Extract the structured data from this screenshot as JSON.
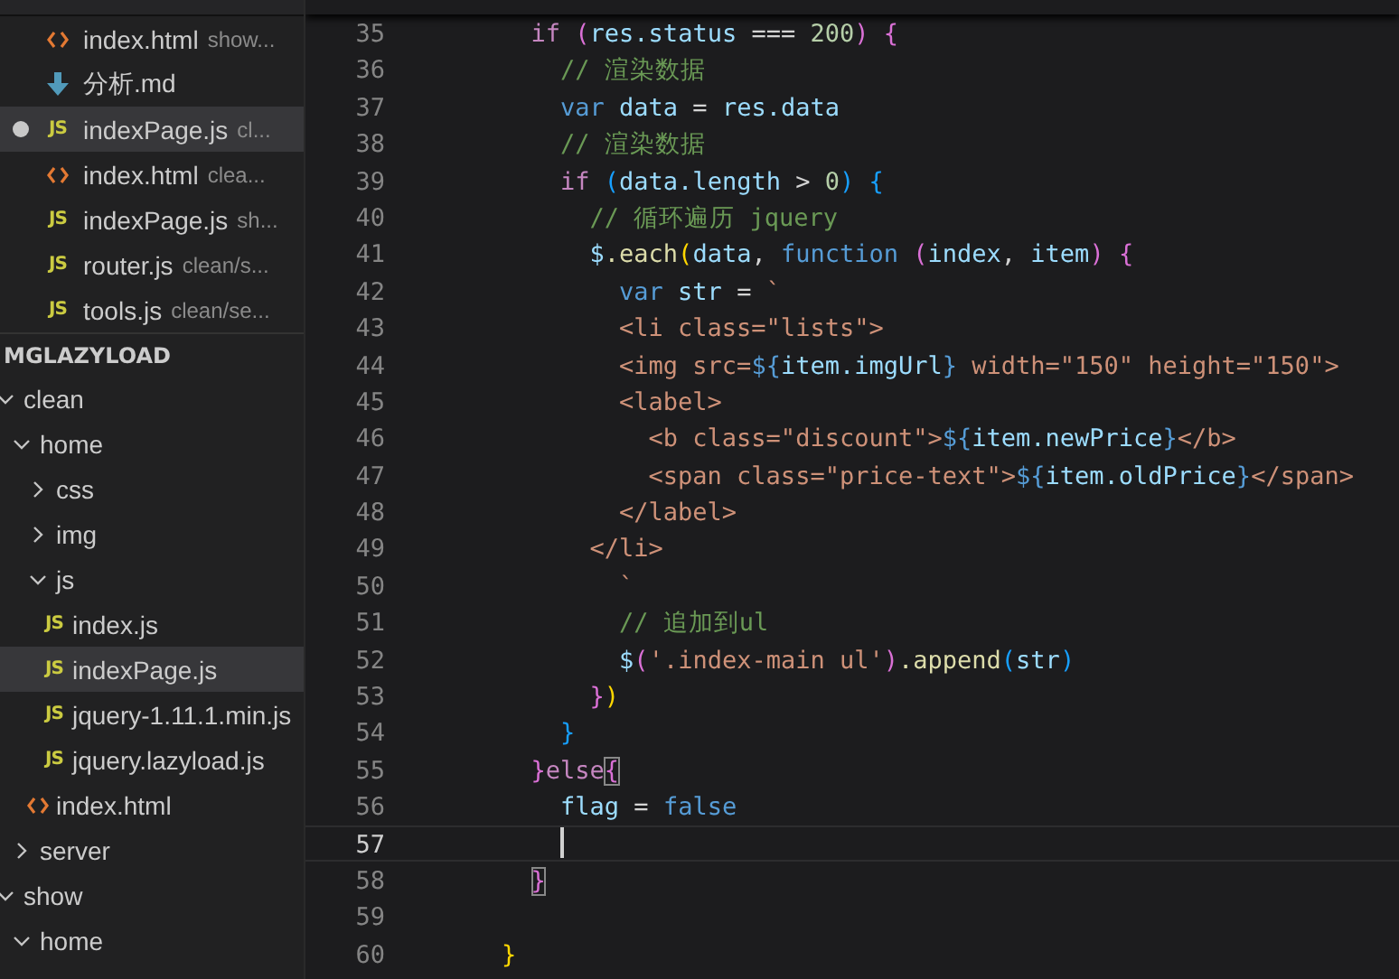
{
  "open_editors": [
    {
      "kind": "html",
      "name": "index.html",
      "path": "show...",
      "modified": false,
      "selected": false
    },
    {
      "kind": "md",
      "name": "分析.md",
      "modified": false,
      "selected": false
    },
    {
      "kind": "js",
      "badge": "JS",
      "name": "indexPage.js",
      "path": "cl...",
      "modified": true,
      "selected": true
    },
    {
      "kind": "html",
      "name": "index.html",
      "path": "clea...",
      "modified": false,
      "selected": false
    },
    {
      "kind": "js",
      "badge": "JS",
      "name": "indexPage.js",
      "path": "sh...",
      "modified": false,
      "selected": false
    },
    {
      "kind": "js",
      "badge": "JS",
      "name": "router.js",
      "path": "clean/s...",
      "modified": false,
      "selected": false
    },
    {
      "kind": "js",
      "badge": "JS",
      "name": "tools.js",
      "path": "clean/se...",
      "modified": false,
      "selected": false
    }
  ],
  "explorer": {
    "title": "MGLAZYLOAD",
    "tree": [
      {
        "kind": "folder",
        "name": "clean",
        "expanded": true,
        "selected": false,
        "children": [
          {
            "kind": "folder",
            "name": "home",
            "expanded": true,
            "selected": false,
            "children": [
              {
                "kind": "folder",
                "name": "css",
                "expanded": false,
                "selected": false
              },
              {
                "kind": "folder",
                "name": "img",
                "expanded": false,
                "selected": false
              },
              {
                "kind": "folder",
                "name": "js",
                "expanded": true,
                "selected": false,
                "children": [
                  {
                    "kind": "js",
                    "badge": "JS",
                    "name": "index.js",
                    "selected": false
                  },
                  {
                    "kind": "js",
                    "badge": "JS",
                    "name": "indexPage.js",
                    "selected": true
                  },
                  {
                    "kind": "js",
                    "badge": "JS",
                    "name": "jquery-1.11.1.min.js",
                    "selected": false
                  },
                  {
                    "kind": "js",
                    "badge": "JS",
                    "name": "jquery.lazyload.js",
                    "selected": false
                  }
                ]
              },
              {
                "kind": "html",
                "name": "index.html",
                "selected": false
              }
            ]
          },
          {
            "kind": "folder",
            "name": "server",
            "expanded": false,
            "selected": false
          }
        ]
      },
      {
        "kind": "folder",
        "name": "show",
        "expanded": true,
        "selected": false,
        "children": [
          {
            "kind": "folder",
            "name": "home",
            "expanded": true,
            "selected": false
          }
        ]
      }
    ]
  },
  "editor": {
    "lines": [
      {
        "number": "35",
        "current": false,
        "tokens": [
          {
            "t": "      if ",
            "kind": "kw"
          },
          {
            "t": "(",
            "kind": "b1"
          },
          {
            "t": "res.status",
            "kind": "var"
          },
          {
            "t": " === ",
            "kind": "p"
          },
          {
            "t": "200",
            "kind": "num"
          },
          {
            "t": ")",
            "kind": "b1"
          },
          {
            "t": " {",
            "kind": "b1"
          }
        ]
      },
      {
        "number": "36",
        "current": false,
        "tokens": [
          {
            "t": "        // 渲染数据",
            "kind": "cm"
          }
        ]
      },
      {
        "number": "37",
        "current": false,
        "tokens": [
          {
            "t": "        var",
            "kind": "st"
          },
          {
            "t": " data",
            "kind": "var"
          },
          {
            "t": " = ",
            "kind": "p"
          },
          {
            "t": "res.data",
            "kind": "var"
          }
        ]
      },
      {
        "number": "38",
        "current": false,
        "tokens": [
          {
            "t": "        // 渲染数据",
            "kind": "cm"
          }
        ]
      },
      {
        "number": "39",
        "current": false,
        "tokens": [
          {
            "t": "        if ",
            "kind": "kw"
          },
          {
            "t": "(",
            "kind": "b2"
          },
          {
            "t": "data.length",
            "kind": "var"
          },
          {
            "t": " > ",
            "kind": "p"
          },
          {
            "t": "0",
            "kind": "num"
          },
          {
            "t": ")",
            "kind": "b2"
          },
          {
            "t": " {",
            "kind": "b2"
          }
        ]
      },
      {
        "number": "40",
        "current": false,
        "tokens": [
          {
            "t": "          // 循环遍历 jquery",
            "kind": "cm"
          }
        ]
      },
      {
        "number": "41",
        "current": false,
        "tokens": [
          {
            "t": "          $",
            "kind": "var"
          },
          {
            "t": ".each",
            "kind": "fn"
          },
          {
            "t": "(",
            "kind": "b3"
          },
          {
            "t": "data",
            "kind": "var"
          },
          {
            "t": ", ",
            "kind": "p"
          },
          {
            "t": "function",
            "kind": "st"
          },
          {
            "t": " (",
            "kind": "b1"
          },
          {
            "t": "index",
            "kind": "var"
          },
          {
            "t": ", ",
            "kind": "p"
          },
          {
            "t": "item",
            "kind": "var"
          },
          {
            "t": ")",
            "kind": "b1"
          },
          {
            "t": " {",
            "kind": "b1"
          }
        ]
      },
      {
        "number": "42",
        "current": false,
        "tokens": [
          {
            "t": "            var",
            "kind": "st"
          },
          {
            "t": " str",
            "kind": "var"
          },
          {
            "t": " = ",
            "kind": "p"
          },
          {
            "t": "`",
            "kind": "str"
          }
        ]
      },
      {
        "number": "43",
        "current": false,
        "tokens": [
          {
            "t": "            <li class=\"lists\">",
            "kind": "str"
          }
        ]
      },
      {
        "number": "44",
        "current": false,
        "tokens": [
          {
            "t": "            <img src=",
            "kind": "str"
          },
          {
            "t": "${",
            "kind": "st"
          },
          {
            "t": "item.imgUrl",
            "kind": "var"
          },
          {
            "t": "}",
            "kind": "st"
          },
          {
            "t": " width=\"150\" height=\"150\">",
            "kind": "str"
          }
        ]
      },
      {
        "number": "45",
        "current": false,
        "tokens": [
          {
            "t": "            <label>",
            "kind": "str"
          }
        ]
      },
      {
        "number": "46",
        "current": false,
        "tokens": [
          {
            "t": "              <b class=\"discount\">",
            "kind": "str"
          },
          {
            "t": "${",
            "kind": "st"
          },
          {
            "t": "item.newPrice",
            "kind": "var"
          },
          {
            "t": "}",
            "kind": "st"
          },
          {
            "t": "</b>",
            "kind": "str"
          }
        ]
      },
      {
        "number": "47",
        "current": false,
        "tokens": [
          {
            "t": "              <span class=\"price-text\">",
            "kind": "str"
          },
          {
            "t": "${",
            "kind": "st"
          },
          {
            "t": "item.oldPrice",
            "kind": "var"
          },
          {
            "t": "}",
            "kind": "st"
          },
          {
            "t": "</span>",
            "kind": "str"
          }
        ]
      },
      {
        "number": "48",
        "current": false,
        "tokens": [
          {
            "t": "            </label>",
            "kind": "str"
          }
        ]
      },
      {
        "number": "49",
        "current": false,
        "tokens": [
          {
            "t": "          </li>",
            "kind": "str"
          }
        ]
      },
      {
        "number": "50",
        "current": false,
        "tokens": [
          {
            "t": "            `",
            "kind": "str"
          }
        ]
      },
      {
        "number": "51",
        "current": false,
        "tokens": [
          {
            "t": "            // 追加到ul",
            "kind": "cm"
          }
        ]
      },
      {
        "number": "52",
        "current": false,
        "tokens": [
          {
            "t": "            $",
            "kind": "var"
          },
          {
            "t": "(",
            "kind": "b1"
          },
          {
            "t": "'.index-main ul'",
            "kind": "str"
          },
          {
            "t": ")",
            "kind": "b1"
          },
          {
            "t": ".append",
            "kind": "fn"
          },
          {
            "t": "(",
            "kind": "b2"
          },
          {
            "t": "str",
            "kind": "var"
          },
          {
            "t": ")",
            "kind": "b2"
          }
        ]
      },
      {
        "number": "53",
        "current": false,
        "tokens": [
          {
            "t": "          }",
            "kind": "b1"
          },
          {
            "t": ")",
            "kind": "b3"
          }
        ]
      },
      {
        "number": "54",
        "current": false,
        "tokens": [
          {
            "t": "        }",
            "kind": "b2"
          }
        ]
      },
      {
        "number": "55",
        "current": false,
        "tokens": [
          {
            "t": "      }",
            "kind": "b1"
          },
          {
            "t": "else",
            "kind": "kw"
          },
          {
            "t": "{",
            "kind": "b1m"
          }
        ]
      },
      {
        "number": "56",
        "current": false,
        "tokens": [
          {
            "t": "        flag",
            "kind": "var"
          },
          {
            "t": " = ",
            "kind": "p"
          },
          {
            "t": "false",
            "kind": "st"
          }
        ]
      },
      {
        "number": "57",
        "current": true
      },
      {
        "number": "58",
        "current": false,
        "tokens": [
          {
            "t": "      }",
            "kind": "b1m"
          }
        ]
      },
      {
        "number": "59",
        "current": false
      },
      {
        "number": "60",
        "current": false,
        "tokens": [
          {
            "t": "    }",
            "kind": "b3"
          }
        ]
      }
    ]
  }
}
